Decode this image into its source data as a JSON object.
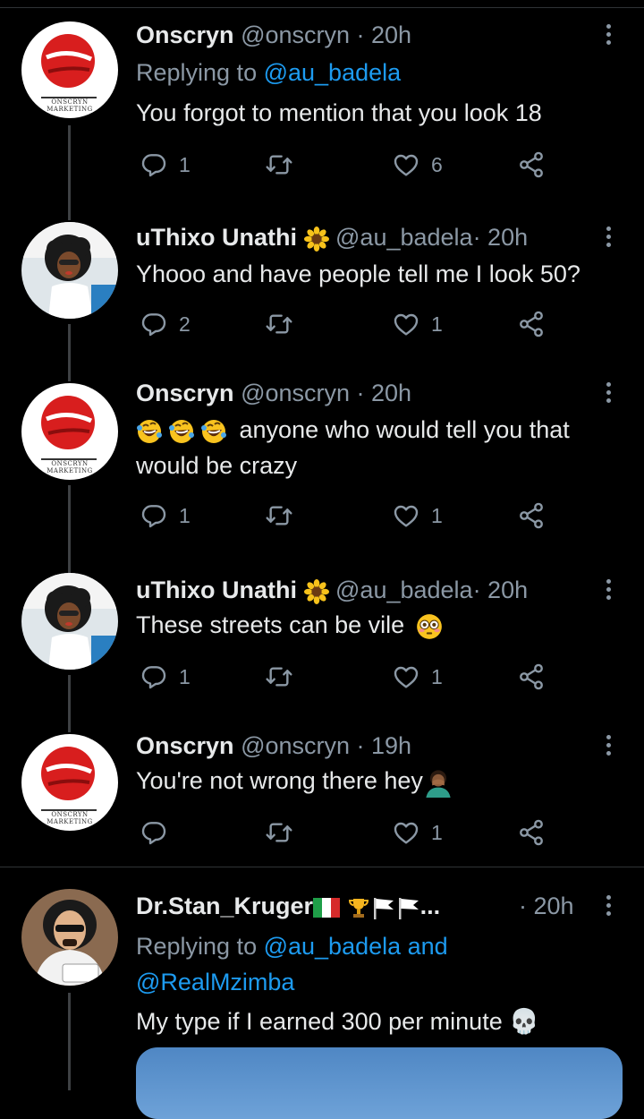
{
  "tweets": [
    {
      "name": "Onscryn",
      "handle": "@onscryn",
      "time": "· 20h",
      "replying_prefix": "Replying to ",
      "replying_to": "@au_badela",
      "text": "You forgot to mention that you look 18",
      "avatar_caption": "ONSCRYN MARKETING",
      "replies": "1",
      "retweets": "",
      "likes": "6"
    },
    {
      "name": "uThixo Unathi",
      "handle": "@au_badela",
      "time": "· 20h",
      "text": "Yhooo and have people tell me I look 50?",
      "replies": "2",
      "retweets": "",
      "likes": "1"
    },
    {
      "name": "Onscryn",
      "handle": "@onscryn",
      "time": "· 20h",
      "text": "anyone who would tell you that would be crazy",
      "avatar_caption": "ONSCRYN MARKETING",
      "replies": "1",
      "retweets": "",
      "likes": "1"
    },
    {
      "name": "uThixo Unathi",
      "handle": "@au_badela",
      "time": "· 20h",
      "text": "These streets can be vile",
      "replies": "1",
      "retweets": "",
      "likes": "1"
    },
    {
      "name": "Onscryn",
      "handle": "@onscryn",
      "time": "· 19h",
      "text": "You're not wrong there hey",
      "avatar_caption": "ONSCRYN MARKETING",
      "replies": "",
      "retweets": "",
      "likes": "1"
    },
    {
      "name": "Dr.Stan_Kruger",
      "name_suffix": "...",
      "time": "· 20h",
      "replying_prefix": "Replying to ",
      "replying_to": "@au_badela and @RealMzimba",
      "text": "My type if I earned 300 per minute 💀"
    }
  ],
  "colors": {
    "background": "#000000",
    "text": "#e7e9ea",
    "secondary": "#8b98a5",
    "link": "#1d9bf0",
    "brand_red": "#d81e1e"
  }
}
